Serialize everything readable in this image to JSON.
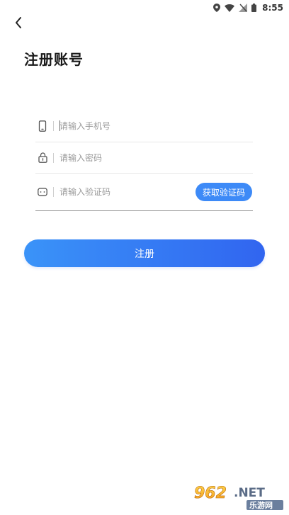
{
  "status_bar": {
    "time": "8:55"
  },
  "page": {
    "title": "注册账号"
  },
  "form": {
    "phone": {
      "placeholder": "请输入手机号",
      "value": "",
      "icon": "phone-icon"
    },
    "password": {
      "placeholder": "请输入密码",
      "value": "",
      "icon": "lock-icon"
    },
    "code": {
      "placeholder": "请输入验证码",
      "value": "",
      "icon": "chat-icon",
      "button_label": "获取验证码"
    },
    "submit_label": "注册"
  },
  "colors": {
    "accent": "#3d8af7",
    "gradient_start": "#3a93f8",
    "gradient_end": "#3165f0"
  },
  "watermark": {
    "text_top": "962.NET",
    "text_bottom": "乐游网"
  }
}
